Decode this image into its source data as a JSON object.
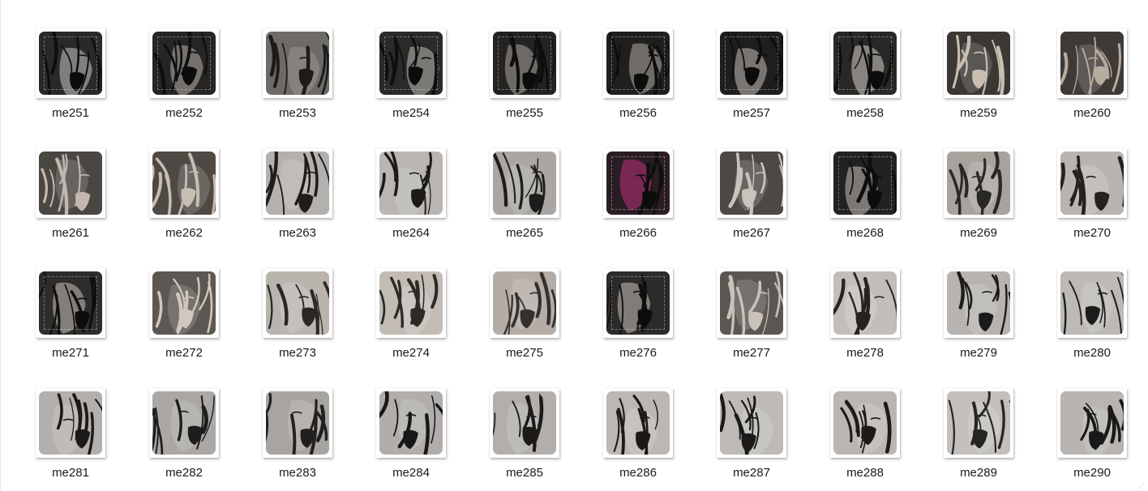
{
  "files": [
    {
      "name": "me251",
      "tone": "dark",
      "bg": "#2a2927",
      "ink": "#c9c7c4"
    },
    {
      "name": "me252",
      "tone": "dark",
      "bg": "#262524",
      "ink": "#b7b2ac"
    },
    {
      "name": "me253",
      "tone": "mid",
      "bg": "#6e6a66",
      "ink": "#1c1b1a"
    },
    {
      "name": "me254",
      "tone": "dark",
      "bg": "#2b2a28",
      "ink": "#bdbab6"
    },
    {
      "name": "me255",
      "tone": "dark",
      "bg": "#242322",
      "ink": "#a9a59f"
    },
    {
      "name": "me256",
      "tone": "dark",
      "bg": "#211f1e",
      "ink": "#b1aca5"
    },
    {
      "name": "me257",
      "tone": "dark",
      "bg": "#1f1e1d",
      "ink": "#c2beb8"
    },
    {
      "name": "me258",
      "tone": "dark",
      "bg": "#2a2826",
      "ink": "#d3cfc9"
    },
    {
      "name": "me259",
      "tone": "mid",
      "bg": "#3a3734",
      "ink": "#c8beb1"
    },
    {
      "name": "me260",
      "tone": "mid",
      "bg": "#3f3a36",
      "ink": "#b8aba0"
    },
    {
      "name": "me261",
      "tone": "mid",
      "bg": "#4a4642",
      "ink": "#c1b7ae"
    },
    {
      "name": "me262",
      "tone": "mid",
      "bg": "#4e4944",
      "ink": "#c7bdb2"
    },
    {
      "name": "me263",
      "tone": "light",
      "bg": "#b3b0ad",
      "ink": "#1e1d1c"
    },
    {
      "name": "me264",
      "tone": "light",
      "bg": "#b8b5b2",
      "ink": "#1b1a19"
    },
    {
      "name": "me265",
      "tone": "light",
      "bg": "#a9a6a3",
      "ink": "#1d1c1b"
    },
    {
      "name": "me266",
      "tone": "dark",
      "bg": "#2a1e24",
      "ink": "#b8327a"
    },
    {
      "name": "me267",
      "tone": "mid",
      "bg": "#4c4844",
      "ink": "#c9c3bc"
    },
    {
      "name": "me268",
      "tone": "dark",
      "bg": "#232221",
      "ink": "#c4c0bb"
    },
    {
      "name": "me269",
      "tone": "light",
      "bg": "#a8a29c",
      "ink": "#2a2825"
    },
    {
      "name": "me270",
      "tone": "light",
      "bg": "#b9b4af",
      "ink": "#242220"
    },
    {
      "name": "me271",
      "tone": "dark",
      "bg": "#2f2d2b",
      "ink": "#c6c2bd"
    },
    {
      "name": "me272",
      "tone": "mid",
      "bg": "#5c5752",
      "ink": "#d1c7bd"
    },
    {
      "name": "me273",
      "tone": "light",
      "bg": "#bab4ae",
      "ink": "#2a2725"
    },
    {
      "name": "me274",
      "tone": "light",
      "bg": "#c3bcb5",
      "ink": "#2c2927"
    },
    {
      "name": "me275",
      "tone": "light",
      "bg": "#b4aca5",
      "ink": "#33302d"
    },
    {
      "name": "me276",
      "tone": "dark",
      "bg": "#2d2b29",
      "ink": "#c4bfb9"
    },
    {
      "name": "me277",
      "tone": "mid",
      "bg": "#5b5651",
      "ink": "#c9c2ba"
    },
    {
      "name": "me278",
      "tone": "light",
      "bg": "#c1beba",
      "ink": "#242322"
    },
    {
      "name": "me279",
      "tone": "light",
      "bg": "#b6b3b0",
      "ink": "#1c1b1a"
    },
    {
      "name": "me280",
      "tone": "light",
      "bg": "#bcb9b6",
      "ink": "#1d1c1b"
    },
    {
      "name": "me281",
      "tone": "light",
      "bg": "#b2afac",
      "ink": "#1b1a19"
    },
    {
      "name": "me282",
      "tone": "light",
      "bg": "#aaa7a4",
      "ink": "#1e1d1c"
    },
    {
      "name": "me283",
      "tone": "light",
      "bg": "#a8a4a0",
      "ink": "#22201e"
    },
    {
      "name": "me284",
      "tone": "light",
      "bg": "#b0adaa",
      "ink": "#181716"
    },
    {
      "name": "me285",
      "tone": "light",
      "bg": "#b1aeab",
      "ink": "#1c1b1a"
    },
    {
      "name": "me286",
      "tone": "light",
      "bg": "#bab7b4",
      "ink": "#1a1918"
    },
    {
      "name": "me287",
      "tone": "light",
      "bg": "#bdbab7",
      "ink": "#1b1a19"
    },
    {
      "name": "me288",
      "tone": "light",
      "bg": "#b9b6b3",
      "ink": "#1c1b1a"
    },
    {
      "name": "me289",
      "tone": "light",
      "bg": "#c2bfbc",
      "ink": "#262524"
    },
    {
      "name": "me290",
      "tone": "light",
      "bg": "#b7b4b1",
      "ink": "#1a1918"
    }
  ]
}
